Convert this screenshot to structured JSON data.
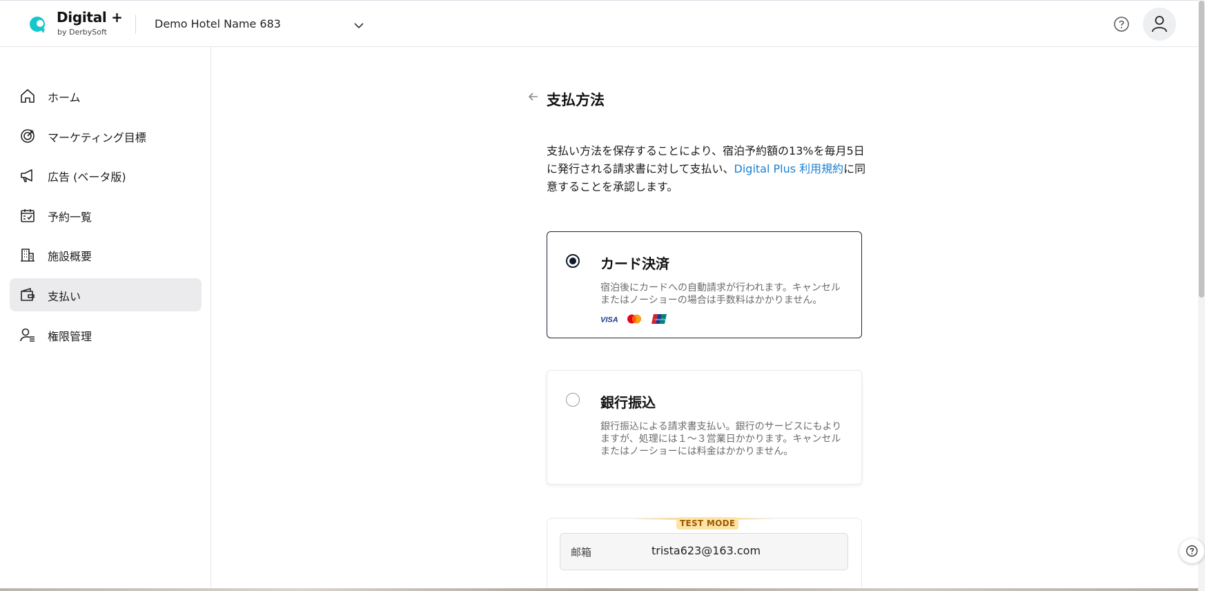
{
  "header": {
    "brand_title": "Digital +",
    "brand_subtitle": "by DerbySoft",
    "hotel_name": "Demo Hotel Name 683",
    "accent_color": "#16c7c9"
  },
  "sidebar": {
    "items": [
      {
        "label": "ホーム",
        "icon": "home-icon"
      },
      {
        "label": "マーケティング目標",
        "icon": "target-icon"
      },
      {
        "label": "広告 (ベータ版)",
        "icon": "megaphone-icon"
      },
      {
        "label": "予約一覧",
        "icon": "calendar-check-icon"
      },
      {
        "label": "施設概要",
        "icon": "building-icon"
      },
      {
        "label": "支払い",
        "icon": "wallet-icon",
        "active": true
      },
      {
        "label": "権限管理",
        "icon": "user-permission-icon"
      }
    ]
  },
  "main": {
    "title": "支払方法",
    "intro_text": "支払い方法を保存することにより、宿泊予約額の13%を毎月5日に発行される請求書に対して支払い、",
    "intro_link": "Digital Plus 利用規約",
    "intro_suffix": "に同意することを承認します。",
    "options": [
      {
        "title": "カード決済",
        "description": "宿泊後にカードへの自動請求が行われます。キャンセルまたはノーショーの場合は手数料はかかりません。",
        "selected": true,
        "card_brands": [
          "VISA",
          "Mastercard",
          "UnionPay"
        ]
      },
      {
        "title": "銀行振込",
        "description": "銀行振込による請求書支払い。銀行のサービスにもよりますが、処理には１〜３営業日かかります。キャンセルまたはノーショーには料金はかかりません。",
        "selected": false
      }
    ],
    "test_mode": {
      "badge": "TEST MODE",
      "email_label": "邮箱",
      "email_value": "trista623@163.com"
    }
  },
  "card_visa_text": "VISA",
  "card_unionpay_text": "UnionPay"
}
